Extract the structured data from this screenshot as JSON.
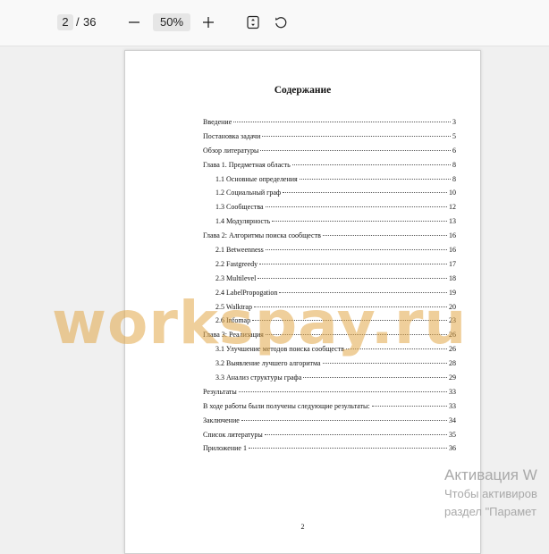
{
  "toolbar": {
    "current_page": "2",
    "separator": "/",
    "total_pages": "36",
    "zoom_level": "50%",
    "icons": {
      "zoom_out": "minus-icon",
      "zoom_in": "plus-icon",
      "fit": "fit-page-icon",
      "rotate": "rotate-icon"
    }
  },
  "document": {
    "title": "Содержание",
    "toc": [
      {
        "label": "Введение",
        "page": "3",
        "level": 0
      },
      {
        "label": "Постановка задачи",
        "page": "5",
        "level": 0
      },
      {
        "label": "Обзор литературы",
        "page": "6",
        "level": 0
      },
      {
        "label": "Глава 1. Предметная область",
        "page": "8",
        "level": 0
      },
      {
        "label": "1.1 Основные определения",
        "page": "8",
        "level": 1
      },
      {
        "label": "1.2 Социальный граф",
        "page": "10",
        "level": 1
      },
      {
        "label": "1.3 Сообщества",
        "page": "12",
        "level": 1
      },
      {
        "label": "1.4 Модулярность",
        "page": "13",
        "level": 1
      },
      {
        "label": "Глава 2: Алгоритмы поиска сообществ",
        "page": "16",
        "level": 0
      },
      {
        "label": "2.1 Betweenness",
        "page": "16",
        "level": 1
      },
      {
        "label": "2.2 Fastgreedy",
        "page": "17",
        "level": 1
      },
      {
        "label": "2.3 Multilevel",
        "page": "18",
        "level": 1
      },
      {
        "label": "2.4 LabelPropogation",
        "page": "19",
        "level": 1
      },
      {
        "label": "2.5 Walktrap",
        "page": "20",
        "level": 1
      },
      {
        "label": "2.6 Infomap",
        "page": "23",
        "level": 1
      },
      {
        "label": "Глава 3: Реализация",
        "page": "26",
        "level": 0
      },
      {
        "label": "3.1 Улучшение методов поиска сообществ",
        "page": "26",
        "level": 1
      },
      {
        "label": "3.2 Выявление лучшего алгоритма",
        "page": "28",
        "level": 1
      },
      {
        "label": "3.3 Анализ структуры графа",
        "page": "29",
        "level": 1
      },
      {
        "label": "Результаты",
        "page": "33",
        "level": 0
      },
      {
        "label": "В ходе работы были получены следующие результаты:",
        "page": "33",
        "level": 0
      },
      {
        "label": "Заключение",
        "page": "34",
        "level": 0
      },
      {
        "label": "Список литературы",
        "page": "35",
        "level": 0
      },
      {
        "label": "Приложение 1",
        "page": "36",
        "level": 0
      }
    ],
    "page_footer": "2",
    "watermark": "workspay.ru"
  },
  "activation": {
    "line1": "Активация W",
    "line2": "Чтобы активиров",
    "line3": "раздел \"Парамет"
  }
}
